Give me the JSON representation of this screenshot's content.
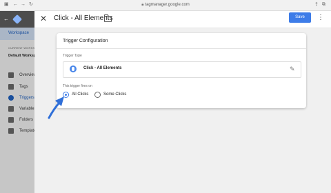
{
  "browser": {
    "url": "tagmanager.google.com"
  },
  "sidebar": {
    "workspace_tab": "Workspace",
    "current_workspace_label": "CURRENT WORKSPACE",
    "workspace_name": "Default Workspace",
    "items": [
      {
        "label": "Overview",
        "icon": "overview-icon"
      },
      {
        "label": "Tags",
        "icon": "tag-icon"
      },
      {
        "label": "Triggers",
        "icon": "trigger-icon",
        "active": true
      },
      {
        "label": "Variables",
        "icon": "variable-icon"
      },
      {
        "label": "Folders",
        "icon": "folder-icon"
      },
      {
        "label": "Templates",
        "icon": "template-icon"
      }
    ]
  },
  "header": {
    "title": "Click - All Elements",
    "save_label": "Save"
  },
  "card": {
    "title": "Trigger Configuration",
    "trigger_type_label": "Trigger Type",
    "trigger_type_name": "Click - All Elements",
    "fires_on_label": "This trigger fires on",
    "options": [
      {
        "label": "All Clicks",
        "selected": true
      },
      {
        "label": "Some Clicks",
        "selected": false
      }
    ]
  },
  "colors": {
    "accent": "#3d7ce8",
    "sidebar_active": "#1a4f9c",
    "annotation_arrow": "#2f6fd8"
  }
}
